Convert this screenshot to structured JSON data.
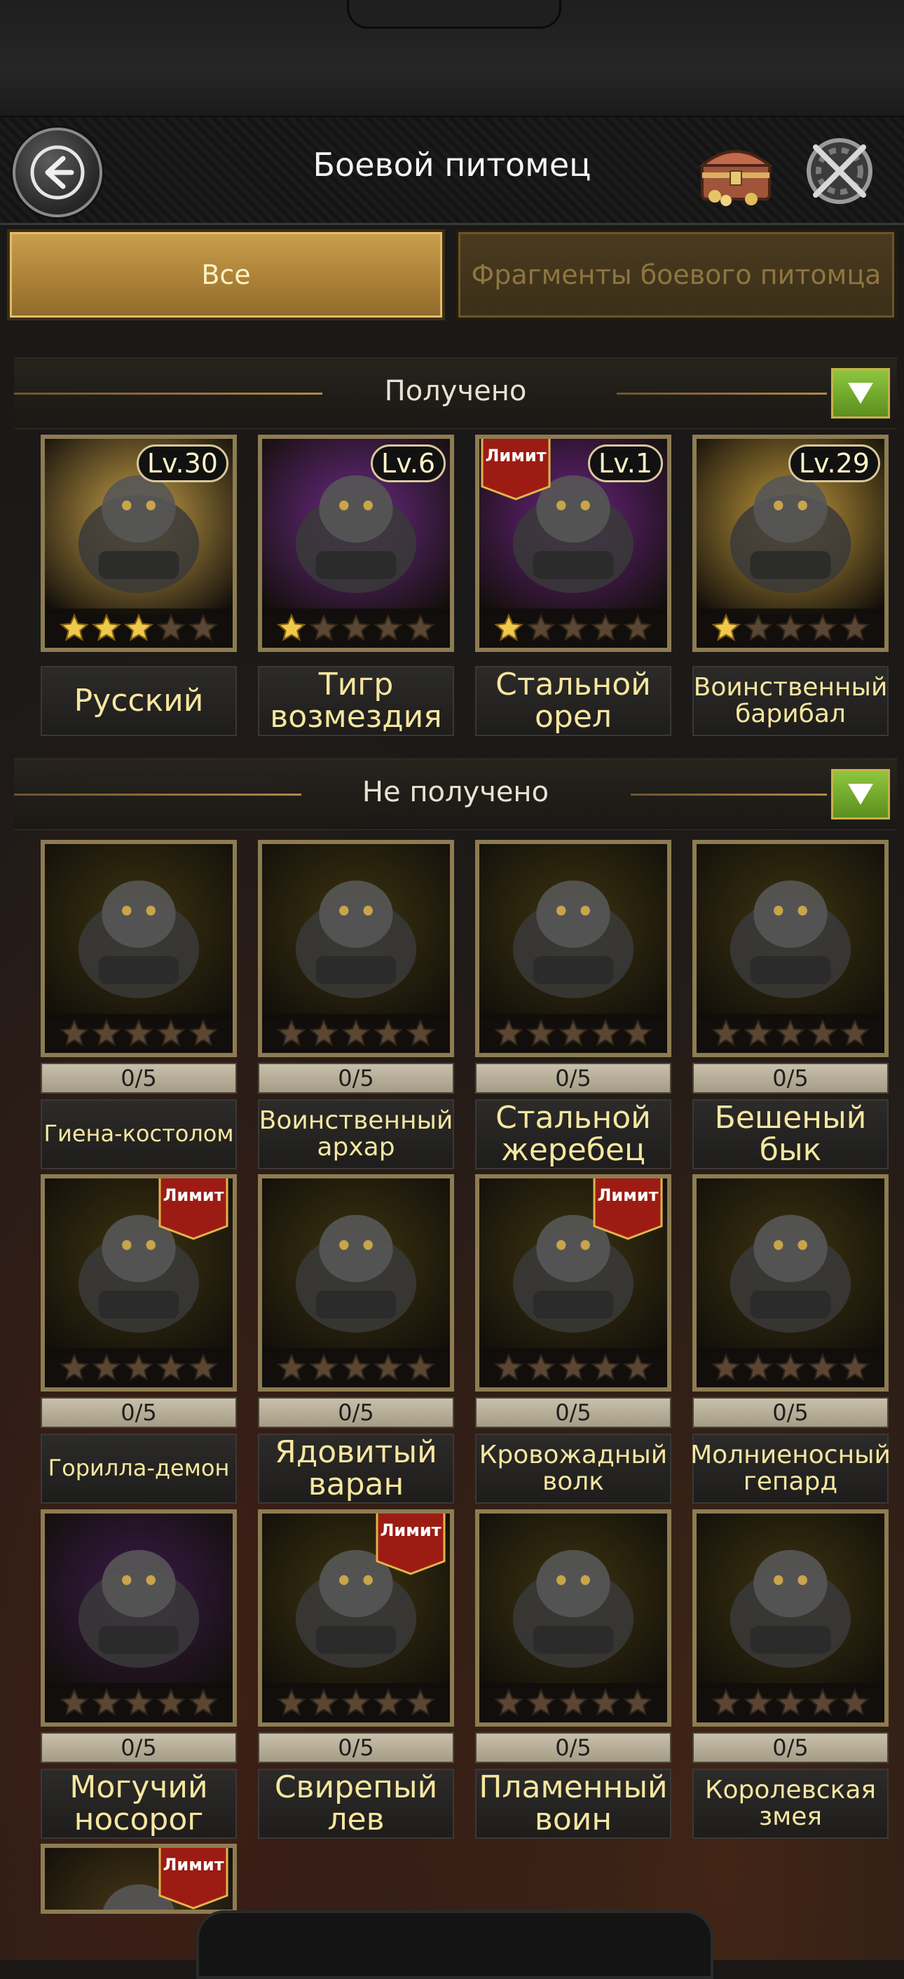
{
  "header": {
    "title": "Боевой питомец"
  },
  "tabs": [
    {
      "label": "Все",
      "active": true
    },
    {
      "label": "Фрагменты боевого питомца",
      "active": false
    }
  ],
  "sections": {
    "owned": {
      "label": "Получено"
    },
    "not_owned": {
      "label": "Не получено"
    }
  },
  "owned_pets": [
    {
      "name": "Русский",
      "level": "Lv.30",
      "stars": 3,
      "limit": false,
      "art": "polar-bear",
      "bg": "#caa24a"
    },
    {
      "name": "Тигр возмездия",
      "level": "Lv.6",
      "stars": 1,
      "limit": false,
      "art": "tiger",
      "bg": "#6d2a86"
    },
    {
      "name": "Стальной орел",
      "level": "Lv.1",
      "stars": 1,
      "limit": true,
      "art": "eagle",
      "bg": "#6a2380"
    },
    {
      "name": "Воинственный барибал",
      "level": "Lv.29",
      "stars": 1,
      "limit": false,
      "art": "black-bear",
      "bg": "#c39a3c"
    }
  ],
  "limit_label": "Лимит",
  "unowned_pets": [
    {
      "name": "Гиена-костолом",
      "progress": "0/5",
      "limit": false,
      "art": "hyena",
      "bg": "#3d3410"
    },
    {
      "name": "Воинственный архар",
      "progress": "0/5",
      "limit": false,
      "art": "ram",
      "bg": "#3d3410"
    },
    {
      "name": "Стальной жеребец",
      "progress": "0/5",
      "limit": false,
      "art": "horse",
      "bg": "#3d3410"
    },
    {
      "name": "Бешеный бык",
      "progress": "0/5",
      "limit": false,
      "art": "bull",
      "bg": "#3d3410"
    },
    {
      "name": "Горилла-демон",
      "progress": "0/5",
      "limit": true,
      "art": "gorilla",
      "bg": "#3d3410"
    },
    {
      "name": "Ядовитый варан",
      "progress": "0/5",
      "limit": false,
      "art": "monitor-lizard",
      "bg": "#3d3410"
    },
    {
      "name": "Кровожадный волк",
      "progress": "0/5",
      "limit": true,
      "art": "wolf",
      "bg": "#3d3410"
    },
    {
      "name": "Молниеносный гепард",
      "progress": "0/5",
      "limit": false,
      "art": "cheetah",
      "bg": "#3d3410"
    },
    {
      "name": "Могучий носорог",
      "progress": "0/5",
      "limit": false,
      "art": "rhino",
      "bg": "#3a1a4a"
    },
    {
      "name": "Свирепый лев",
      "progress": "0/5",
      "limit": true,
      "art": "lion",
      "bg": "#3d3410"
    },
    {
      "name": "Пламенный воин",
      "progress": "0/5",
      "limit": false,
      "art": "flamingo",
      "bg": "#3d3410"
    },
    {
      "name": "Королевская змея",
      "progress": "0/5",
      "limit": false,
      "art": "cobra",
      "bg": "#3d3410"
    },
    {
      "name": "",
      "progress": "",
      "limit": true,
      "art": "partial",
      "bg": "#4a3a18"
    }
  ]
}
